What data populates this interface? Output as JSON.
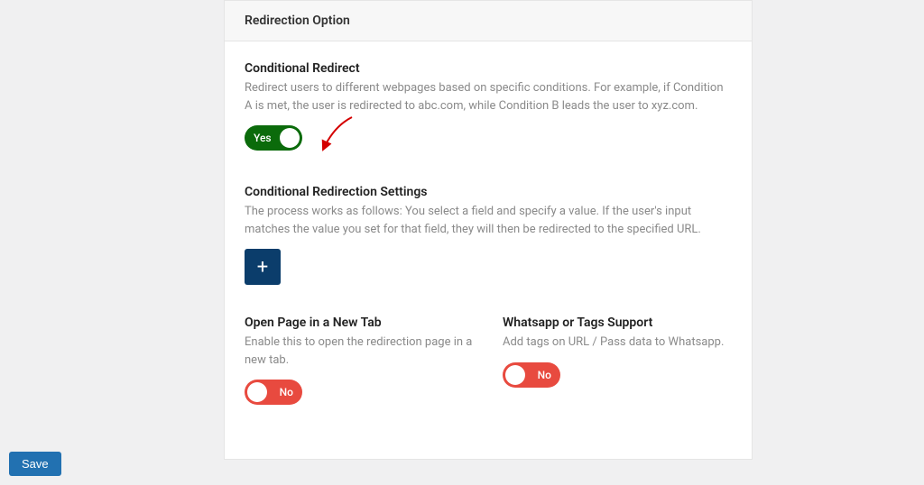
{
  "header": {
    "title": "Redirection Option"
  },
  "settings": {
    "conditional_redirect": {
      "title": "Conditional Redirect",
      "desc": "Redirect users to different webpages based on specific conditions. For example, if Condition A is met, the user is redirected to abc.com, while Condition B leads the user to xyz.com.",
      "toggle_label": "Yes"
    },
    "conditional_settings": {
      "title": "Conditional Redirection Settings",
      "desc": "The process works as follows: You select a field and specify a value. If the user's input matches the value you set for that field, they will then be redirected to the specified URL.",
      "add_label": "+"
    },
    "open_new_tab": {
      "title": "Open Page in a New Tab",
      "desc": "Enable this to open the redirection page in a new tab.",
      "toggle_label": "No"
    },
    "whatsapp_tags": {
      "title": "Whatsapp or Tags Support",
      "desc": "Add tags on URL / Pass data to Whatsapp.",
      "toggle_label": "No"
    }
  },
  "footer": {
    "save_label": "Save"
  }
}
